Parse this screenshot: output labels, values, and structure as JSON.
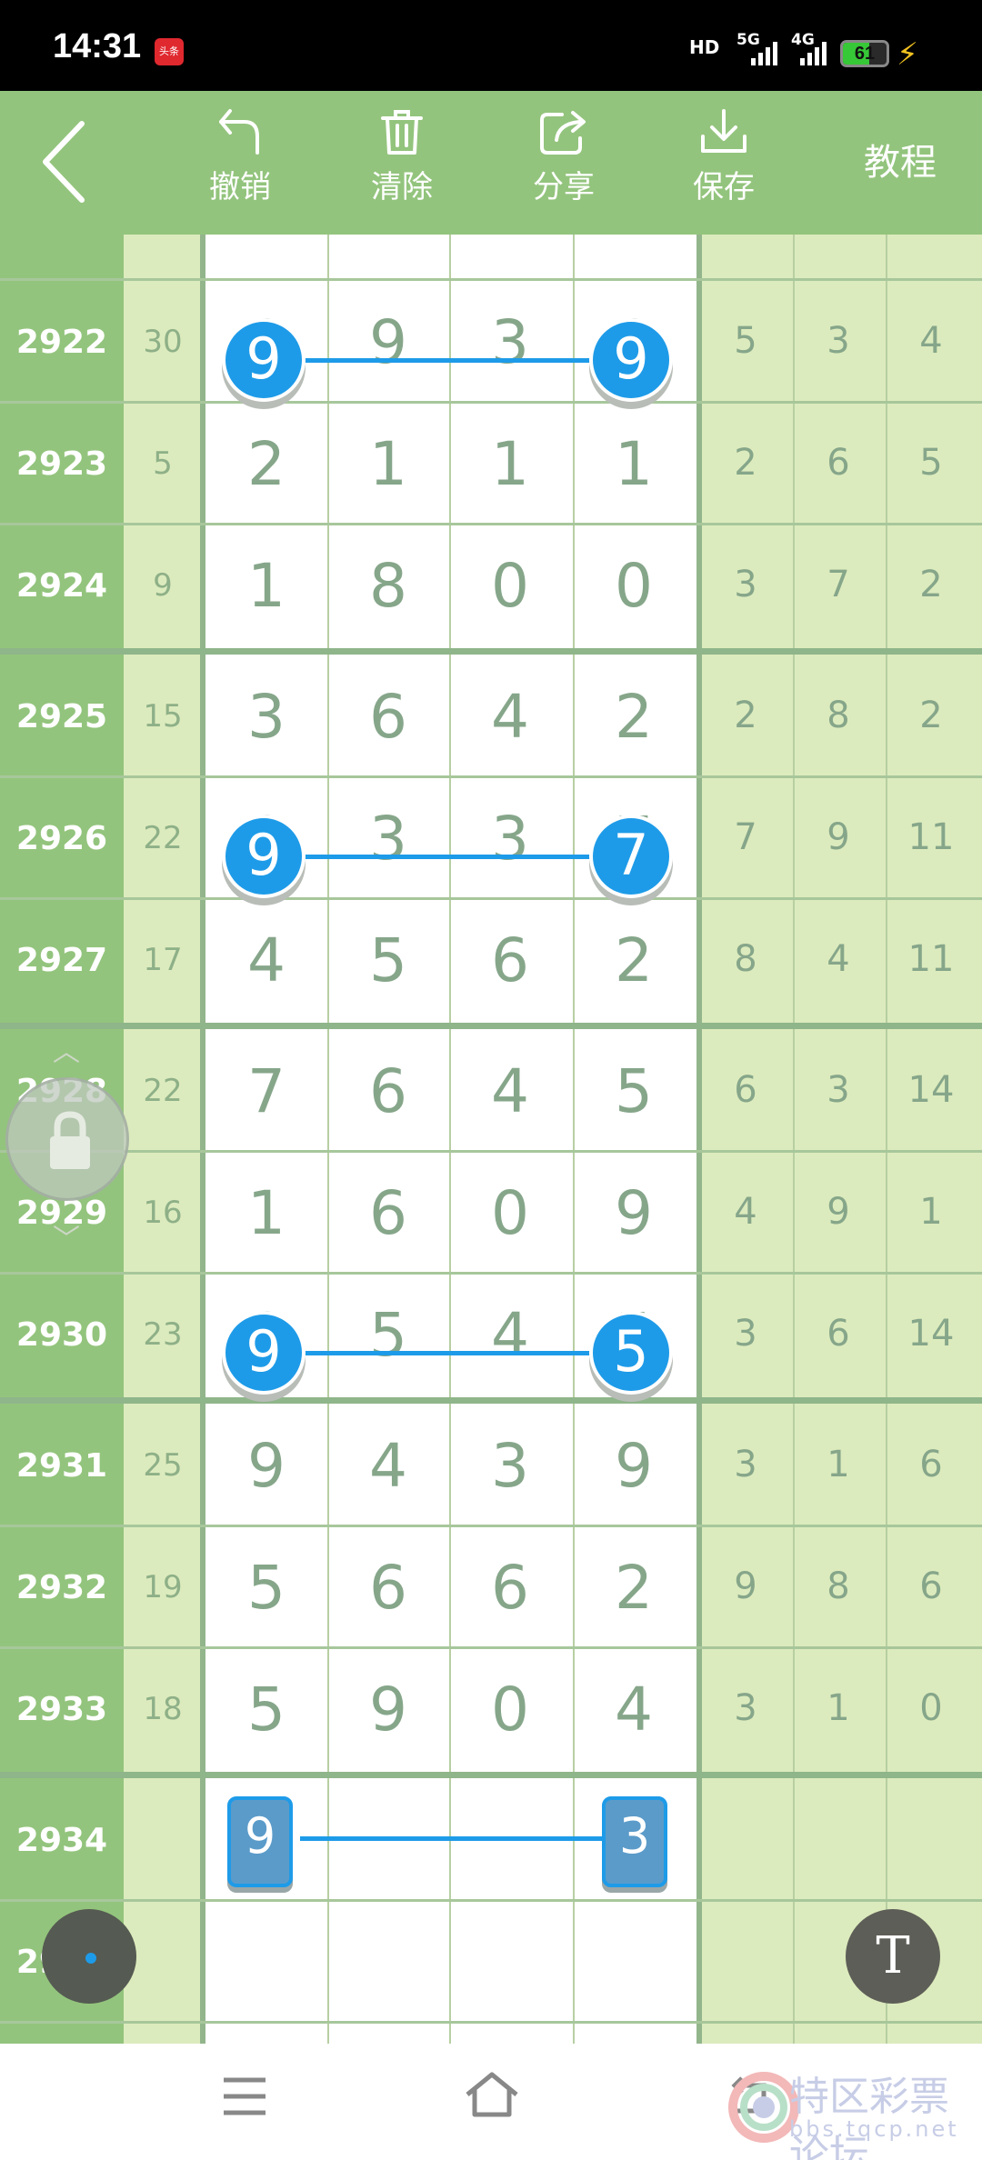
{
  "status_bar": {
    "time": "14:31",
    "news_app": "头条",
    "hd_badge": "HD",
    "sim1_network": "5G",
    "sim2_network": "4G",
    "battery_level": "61",
    "battery_fraction": 0.61
  },
  "toolbar": {
    "undo_label": "撤销",
    "clear_label": "清除",
    "share_label": "分享",
    "save_label": "保存",
    "tutorial_label": "教程"
  },
  "rows": [
    {
      "issue": "2922",
      "sum": "30",
      "digits": [
        "9",
        "9",
        "3",
        "9"
      ],
      "right": [
        "5",
        "3",
        "4"
      ]
    },
    {
      "issue": "2923",
      "sum": "5",
      "digits": [
        "2",
        "1",
        "1",
        "1"
      ],
      "right": [
        "2",
        "6",
        "5"
      ]
    },
    {
      "issue": "2924",
      "sum": "9",
      "digits": [
        "1",
        "8",
        "0",
        "0"
      ],
      "right": [
        "3",
        "7",
        "2"
      ]
    },
    {
      "issue": "2925",
      "sum": "15",
      "digits": [
        "3",
        "6",
        "4",
        "2"
      ],
      "right": [
        "2",
        "8",
        "2"
      ]
    },
    {
      "issue": "2926",
      "sum": "22",
      "digits": [
        "9",
        "3",
        "3",
        "7"
      ],
      "right": [
        "7",
        "9",
        "11"
      ]
    },
    {
      "issue": "2927",
      "sum": "17",
      "digits": [
        "4",
        "5",
        "6",
        "2"
      ],
      "right": [
        "8",
        "4",
        "11"
      ]
    },
    {
      "issue": "2928",
      "sum": "22",
      "digits": [
        "7",
        "6",
        "4",
        "5"
      ],
      "right": [
        "6",
        "3",
        "14"
      ]
    },
    {
      "issue": "2929",
      "sum": "16",
      "digits": [
        "1",
        "6",
        "0",
        "9"
      ],
      "right": [
        "4",
        "9",
        "1"
      ]
    },
    {
      "issue": "2930",
      "sum": "23",
      "digits": [
        "9",
        "5",
        "4",
        "5"
      ],
      "right": [
        "3",
        "6",
        "14"
      ]
    },
    {
      "issue": "2931",
      "sum": "25",
      "digits": [
        "9",
        "4",
        "3",
        "9"
      ],
      "right": [
        "3",
        "1",
        "6"
      ]
    },
    {
      "issue": "2932",
      "sum": "19",
      "digits": [
        "5",
        "6",
        "6",
        "2"
      ],
      "right": [
        "9",
        "8",
        "6"
      ]
    },
    {
      "issue": "2933",
      "sum": "18",
      "digits": [
        "5",
        "9",
        "0",
        "4"
      ],
      "right": [
        "3",
        "1",
        "0"
      ]
    },
    {
      "issue": "2934",
      "sum": "",
      "digits": [
        "",
        "",
        "",
        ""
      ],
      "right": [
        "",
        "",
        ""
      ]
    },
    {
      "issue": "2935",
      "sum": "",
      "digits": [
        "",
        "",
        "",
        ""
      ],
      "right": [
        "",
        "",
        ""
      ]
    }
  ],
  "marked_rows": [
    {
      "row": 0,
      "first": "9",
      "last": "9"
    },
    {
      "row": 4,
      "first": "9",
      "last": "7"
    },
    {
      "row": 8,
      "first": "9",
      "last": "5"
    }
  ],
  "pending_row": {
    "row": 12,
    "first": "9",
    "last": "3"
  },
  "floating": {
    "text_tool": "T"
  },
  "watermark": {
    "text": "特区彩票论坛",
    "sub": "bbs.tqcp.net"
  },
  "colors": {
    "accent": "#1e9be8",
    "header_green": "#93c47d",
    "pale_green": "#dcebbd"
  }
}
